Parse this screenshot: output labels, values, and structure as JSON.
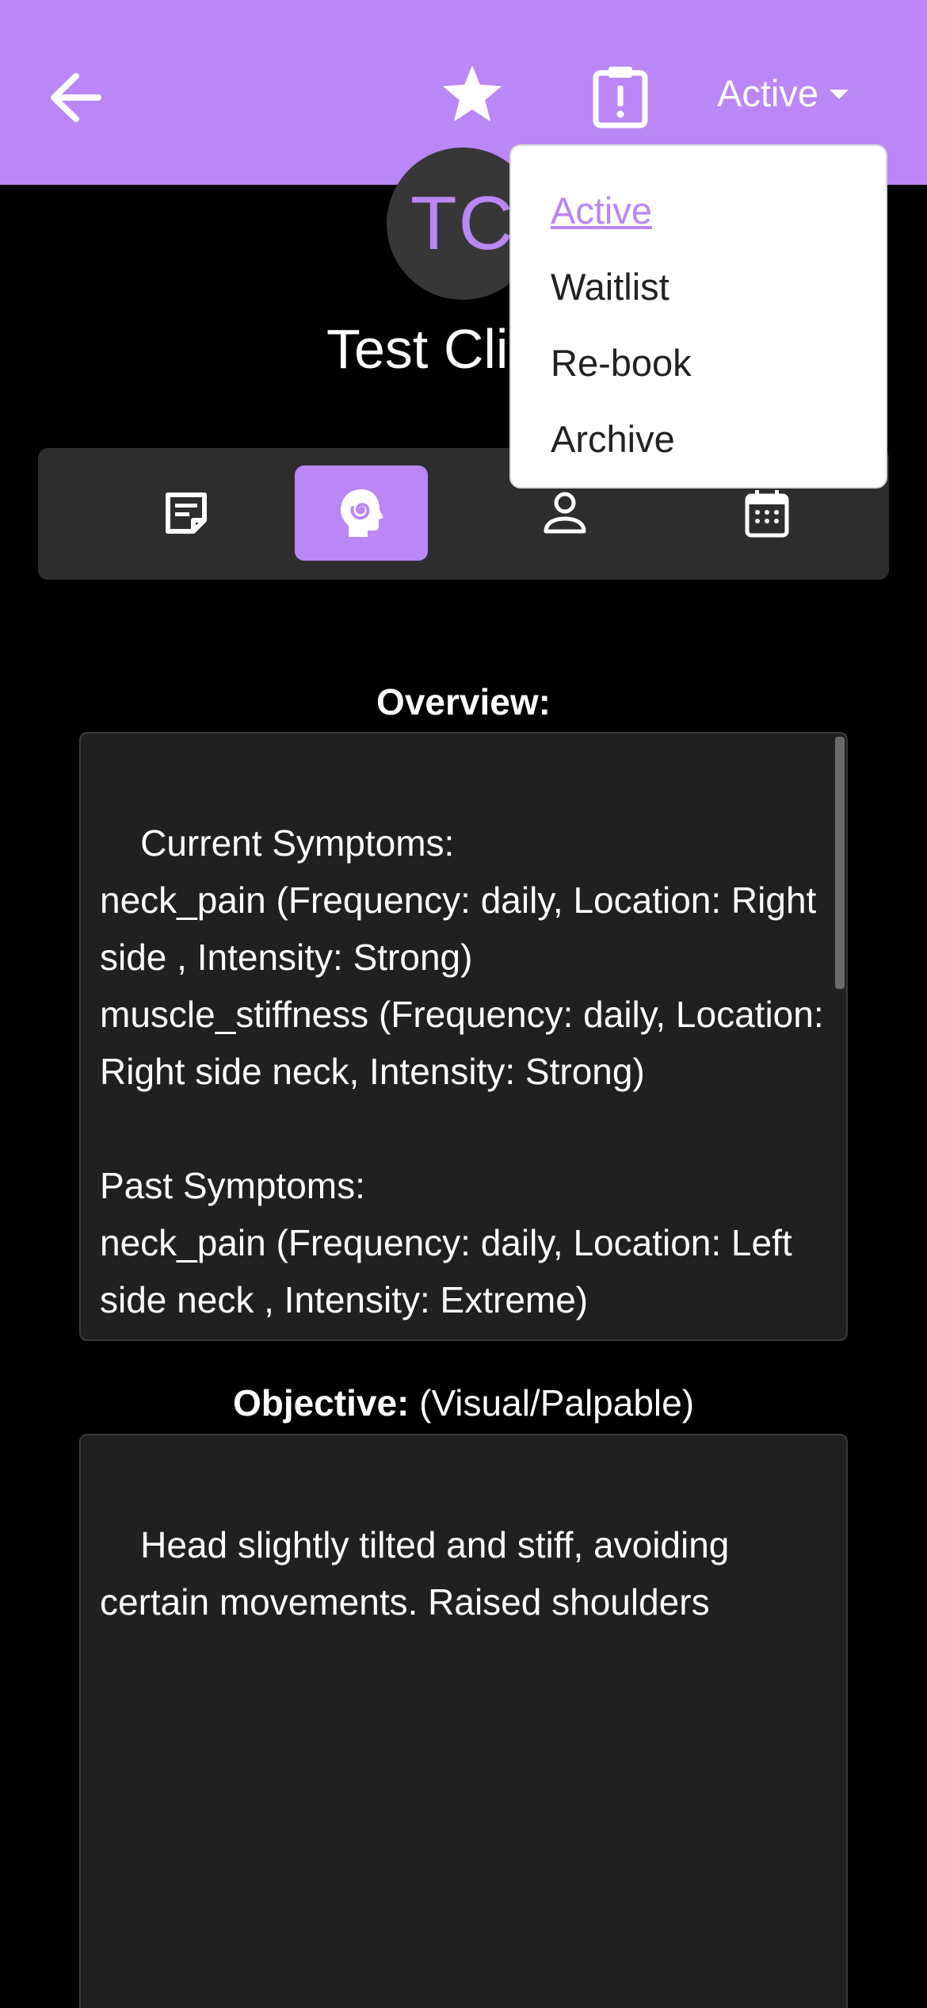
{
  "header": {
    "back_icon": "arrow-left-icon",
    "star_icon": "star-icon",
    "clipboard_icon": "clipboard-alert-icon",
    "status_label": "Active",
    "accent_color": "#bb86f5"
  },
  "client": {
    "initials": "TC",
    "name": "Test Cli"
  },
  "status_menu": {
    "items": [
      {
        "label": "Active",
        "selected": true
      },
      {
        "label": "Waitlist"
      },
      {
        "label": "Re-book"
      },
      {
        "label": "Archive"
      }
    ]
  },
  "tabs": [
    {
      "icon": "notes-icon"
    },
    {
      "icon": "head-spiral-icon",
      "selected": true
    },
    {
      "icon": "person-icon"
    },
    {
      "icon": "calendar-icon"
    }
  ],
  "overview": {
    "title": "Overview:",
    "text": "Current Symptoms:\nneck_pain (Frequency: daily, Location: Right side , Intensity: Strong)\nmuscle_stiffness (Frequency: daily, Location: Right side neck, Intensity: Strong)\n\nPast Symptoms:\nneck_pain (Frequency: daily, Location: Left side neck , Intensity: Extreme)\nmuscle_stiffness (Frequency: daily,"
  },
  "objective": {
    "title": "Objective:",
    "subtitle": "(Visual/Palpable)",
    "text": "Head slightly tilted and stiff, avoiding certain movements. Raised shoulders"
  }
}
